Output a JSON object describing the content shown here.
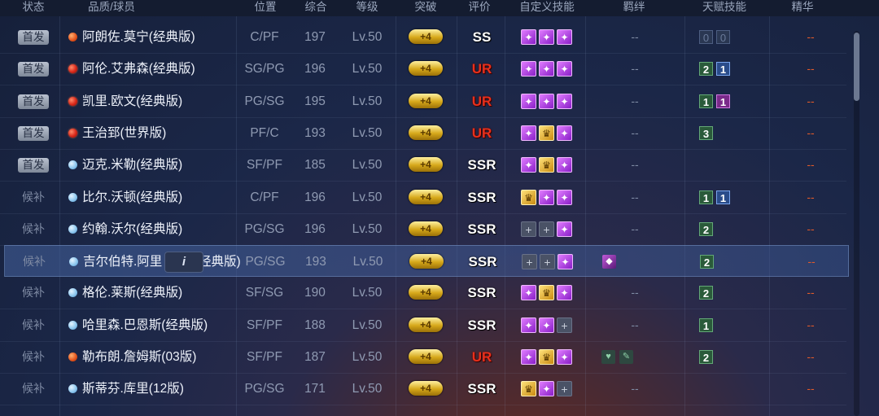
{
  "headers": {
    "status": "状态",
    "player": "品质/球员",
    "position": "位置",
    "overall": "综合",
    "level": "等级",
    "breakthrough": "突破",
    "grade": "评价",
    "custom_skills": "自定义技能",
    "fetters": "羁绊",
    "talents": "天赋技能",
    "essence": "精华"
  },
  "status_starter": "首发",
  "status_bench": "候补",
  "placeholder_dash": "--",
  "breakthrough_label": "+4",
  "info_button_label": "i",
  "colors": {
    "grade_ur": "#e8301c",
    "essence": "#e05a2a"
  },
  "rows": [
    {
      "status": "首发",
      "dot": "orange",
      "name": "阿朗佐.莫宁(经典版)",
      "position": "C/PF",
      "overall": "197",
      "level": "Lv.50",
      "grade": "SS",
      "skills": [
        "purple",
        "purple",
        "purple"
      ],
      "fetters": "--",
      "talents": [
        {
          "type": "empty",
          "value": "0"
        },
        {
          "type": "empty",
          "value": "0"
        }
      ],
      "essence": "--"
    },
    {
      "status": "首发",
      "dot": "red",
      "name": "阿伦.艾弗森(经典版)",
      "position": "SG/PG",
      "overall": "196",
      "level": "Lv.50",
      "grade": "UR",
      "skills": [
        "purple",
        "purple",
        "purple"
      ],
      "fetters": "--",
      "talents": [
        {
          "type": "green",
          "value": "2"
        },
        {
          "type": "blue",
          "value": "1"
        }
      ],
      "essence": "--"
    },
    {
      "status": "首发",
      "dot": "red",
      "name": "凯里.欧文(经典版)",
      "position": "PG/SG",
      "overall": "195",
      "level": "Lv.50",
      "grade": "UR",
      "skills": [
        "purple",
        "purple",
        "purple"
      ],
      "fetters": "--",
      "talents": [
        {
          "type": "green",
          "value": "1"
        },
        {
          "type": "purple",
          "value": "1"
        }
      ],
      "essence": "--"
    },
    {
      "status": "首发",
      "dot": "red",
      "name": "王治郅(世界版)",
      "position": "PF/C",
      "overall": "193",
      "level": "Lv.50",
      "grade": "UR",
      "skills": [
        "purple",
        "gold",
        "purple"
      ],
      "fetters": "--",
      "talents": [
        {
          "type": "green",
          "value": "3"
        }
      ],
      "essence": "--"
    },
    {
      "status": "首发",
      "dot": "blue",
      "name": "迈克.米勒(经典版)",
      "position": "SF/PF",
      "overall": "185",
      "level": "Lv.50",
      "grade": "SSR",
      "skills": [
        "purple",
        "gold",
        "purple"
      ],
      "fetters": "--",
      "talents": [],
      "essence": "--"
    },
    {
      "status": "候补",
      "dot": "blue",
      "name": "比尔.沃顿(经典版)",
      "position": "C/PF",
      "overall": "196",
      "level": "Lv.50",
      "grade": "SSR",
      "skills": [
        "gold",
        "purple",
        "purple"
      ],
      "fetters": "--",
      "talents": [
        {
          "type": "green",
          "value": "1"
        },
        {
          "type": "blue",
          "value": "1"
        }
      ],
      "essence": "--"
    },
    {
      "status": "候补",
      "dot": "blue",
      "name": "约翰.沃尔(经典版)",
      "position": "PG/SG",
      "overall": "196",
      "level": "Lv.50",
      "grade": "SSR",
      "skills": [
        "empty",
        "empty",
        "purple"
      ],
      "fetters": "--",
      "talents": [
        {
          "type": "green",
          "value": "2"
        }
      ],
      "essence": "--"
    },
    {
      "status": "候补",
      "dot": "blue",
      "name": "吉尔伯特.阿里",
      "name_tail": "经典版)",
      "position": "PG/SG",
      "overall": "193",
      "level": "Lv.50",
      "grade": "SSR",
      "skills": [
        "empty",
        "empty",
        "purple"
      ],
      "fetters": "purple",
      "talents": [
        {
          "type": "green",
          "value": "2"
        }
      ],
      "essence": "--",
      "selected": true
    },
    {
      "status": "候补",
      "dot": "blue",
      "name": "格伦.莱斯(经典版)",
      "position": "SF/SG",
      "overall": "190",
      "level": "Lv.50",
      "grade": "SSR",
      "skills": [
        "purple",
        "gold",
        "purple"
      ],
      "fetters": "--",
      "talents": [
        {
          "type": "green",
          "value": "2"
        }
      ],
      "essence": "--"
    },
    {
      "status": "候补",
      "dot": "blue",
      "name": "哈里森.巴恩斯(经典版)",
      "position": "SF/PF",
      "overall": "188",
      "level": "Lv.50",
      "grade": "SSR",
      "skills": [
        "purple",
        "purple",
        "empty"
      ],
      "fetters": "--",
      "talents": [
        {
          "type": "green",
          "value": "1"
        }
      ],
      "essence": "--"
    },
    {
      "status": "候补",
      "dot": "orange",
      "name": "勒布朗.詹姆斯(03版)",
      "position": "SF/PF",
      "overall": "187",
      "level": "Lv.50",
      "grade": "UR",
      "skills": [
        "purple",
        "gold",
        "purple"
      ],
      "fetters": "green2",
      "talents": [
        {
          "type": "green",
          "value": "2"
        }
      ],
      "essence": "--"
    },
    {
      "status": "候补",
      "dot": "blue",
      "name": "斯蒂芬.库里(12版)",
      "position": "PG/SG",
      "overall": "171",
      "level": "Lv.50",
      "grade": "SSR",
      "skills": [
        "gold",
        "purple",
        "empty"
      ],
      "fetters": "--",
      "talents": [],
      "essence": "--"
    }
  ]
}
